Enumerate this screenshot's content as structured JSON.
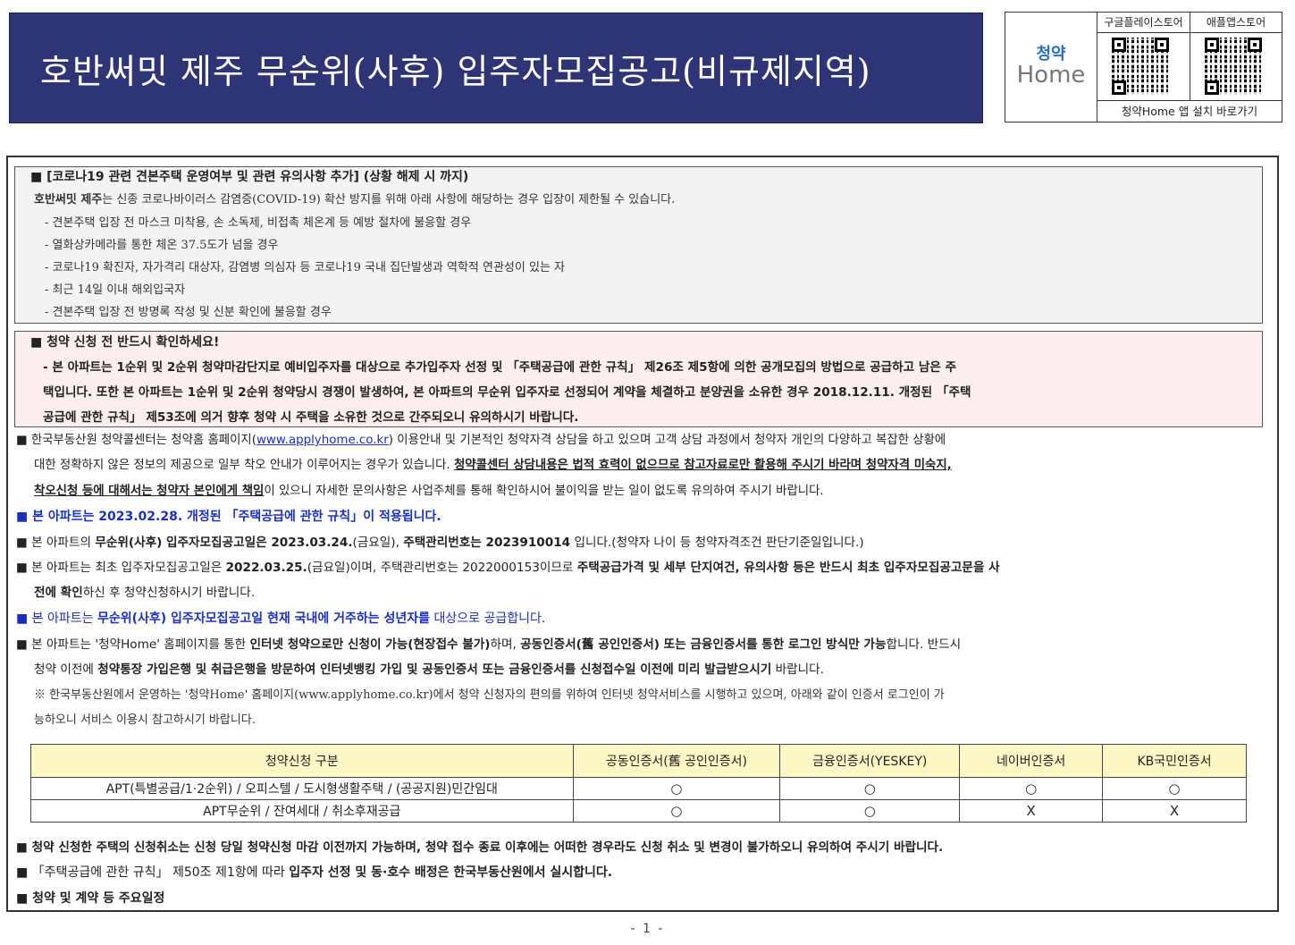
{
  "title": "호반써밋 제주 무순위(사후) 입주자모집공고(비규제지역)",
  "logo": {
    "top": "청약",
    "bottom": "Home",
    "store1_label": "구글플레이스토어",
    "store2_label": "애플앱스토어",
    "caption": "청약Home 앱 설치 바로가기",
    "qr1": "qr-code-icon",
    "qr2": "qr-code-icon"
  },
  "covid": {
    "heading": "■ [코로나19 관련 견본주택 운영여부 및 관련 유의사항 추가] (상황 해제 시 까지)",
    "intro_bold": "호반써밋 제주",
    "intro_rest": "는 신종 코로나바이러스 감염증(COVID-19) 확산 방지를 위해 아래 사항에 해당하는 경우 입장이 제한될 수 있습니다.",
    "items": [
      "- 견본주택 입장 전 마스크 미착용, 손 소독제, 비접촉 체온계 등 예방 절차에 불응할 경우",
      "- 열화상카메라를 통한 체온 37.5도가 넘을 경우",
      "- 코로나19 확진자, 자가격리 대상자, 감염병 의심자 등 코로나19 국내 집단발생과 역학적 연관성이 있는 자",
      "- 최근 14일 이내 해외입국자",
      "- 견본주택 입장 전 방명록 작성 및 신분 확인에 불응할 경우"
    ]
  },
  "warning": {
    "heading": "■ 청약 신청 전 반드시 확인하세요!",
    "lines": [
      "- 본 아파트는 1순위 및 2순위 청약마감단지로 예비입주자를 대상으로 추가입주자 선정 및 「주택공급에 관한 규칙」 제26조 제5항에 의한 공개모집의 방법으로 공급하고 남은 주",
      "택입니다. 또한 본 아파트는 1순위 및 2순위 청약당시 경쟁이 발생하여, 본 아파트의 무순위 입주자로 선정되어 계약을 체결하고 분양권을 소유한 경우 2018.12.11. 개정된 「주택",
      "공급에 관한 규칙」 제53조에 의거 향후 청약 시 주택을 소유한 것으로 간주되오니 유의하시기 바랍니다."
    ]
  },
  "p1": {
    "a": "■ 한국부동산원 청약콜센터는 청약홈 홈페이지(",
    "link": "www.applyhome.co.kr",
    "b": ") 이용안내 및 기본적인 청약자격 상담을 하고 있으며 고객 상담 과정에서 청약자 개인의 다양하고 복잡한 상황에",
    "c": "대한 정확하지 않은 정보의 제공으로 일부 착오 안내가 이루어지는 경우가 있습니다. ",
    "c_bold": "청약콜센터 상담내용은 법적 효력이 없으므로 참고자료로만 활용해 주시기 바라며 청약자격 미숙지,",
    "d_bold": "착오신청 등에 대해서는 청약자 본인에게 책임",
    "d": "이 있으니 자세한 문의사항은 사업주체를 통해 확인하시어 불이익을 받는 일이 없도록 유의하여 주시기 바랍니다."
  },
  "p2": "■ 본 아파트는 2023.02.28. 개정된 「주택공급에 관한 규칙」이 적용됩니다.",
  "p3": {
    "a": "■ 본 아파트의 ",
    "b": "무순위(사후) 입주자모집공고일은 2023.03.24.",
    "c": "(금요일), ",
    "d": "주택관리번호는 2023910014",
    "e": " 입니다.(청약자 나이 등 청약자격조건 판단기준일입니다.)"
  },
  "p4": {
    "a": "■ 본 아파트는 최초 입주자모집공고일은 ",
    "b": "2022.03.25.",
    "c": "(금요일)이며, 주택관리번호는 2022000153이므로 ",
    "d": "주택공급가격 및 세부 단지여건, 유의사항 등은 반드시 최초 입주자모집공고문을 사",
    "e": "전에 확인",
    "f": "하신 후 청약신청하시기 바랍니다."
  },
  "p5": {
    "a": "■ 본 아파트는 ",
    "b": "무순위(사후) 입주자모집공고일 현재 국내에 거주하는 성년자를",
    "c": " 대상으로 공급합니다."
  },
  "p6": {
    "a": "■ 본 아파트는 '청약Home' 홈페이지를 통한 ",
    "b": "인터넷 청약으로만 신청이 가능(현장접수 불가)",
    "c": "하며, ",
    "d": "공동인증서(舊 공인인증서) 또는 금융인증서를 통한 로그인 방식만 가능",
    "e": "합니다. 반드시",
    "f": "청약 이전에 ",
    "g": "청약통장 가입은행 및 취급은행을 방문하여 인터넷뱅킹 가입 및 공동인증서 또는 금융인증서를 신청접수일 이전에 미리 발급받으시기",
    "h": " 바랍니다.",
    "note1": "※ 한국부동산원에서 운영하는 '청약Home' 홈페이지(www.applyhome.co.kr)에서 청약 신청자의 편의를 위하여 인터넷 청약서비스를 시행하고 있으며, 아래와 같이 인증서 로그인이 가",
    "note2": "능하오니 서비스 이용시 참고하시기 바랍니다."
  },
  "table": {
    "headers": [
      "청약신청 구분",
      "공동인증서(舊 공인인증서)",
      "금융인증서(YESKEY)",
      "네이버인증서",
      "KB국민인증서"
    ],
    "rows": [
      [
        "APT(특별공급/1·2순위) / 오피스텔 / 도시형생활주택 / (공공지원)민간임대",
        "○",
        "○",
        "○",
        "○"
      ],
      [
        "APT무순위 / 잔여세대 / 취소후재공급",
        "○",
        "○",
        "X",
        "X"
      ]
    ]
  },
  "p7": "■ 청약 신청한 주택의 신청취소는 신청 당일 청약신청 마감 이전까지 가능하며, 청약 접수 종료 이후에는 어떠한 경우라도 신청 취소 및 변경이 불가하오니 유의하여 주시기 바랍니다.",
  "p8": {
    "a": "■ 「주택공급에 관한 규칙」 제50조 제1항에 따라 ",
    "b": "입주자 선정 및 동·호수 배정은 한국부동산원에서 실시합니다."
  },
  "p9": "■ 청약 및 계약 등 주요일정",
  "page_number": "- 1 -"
}
